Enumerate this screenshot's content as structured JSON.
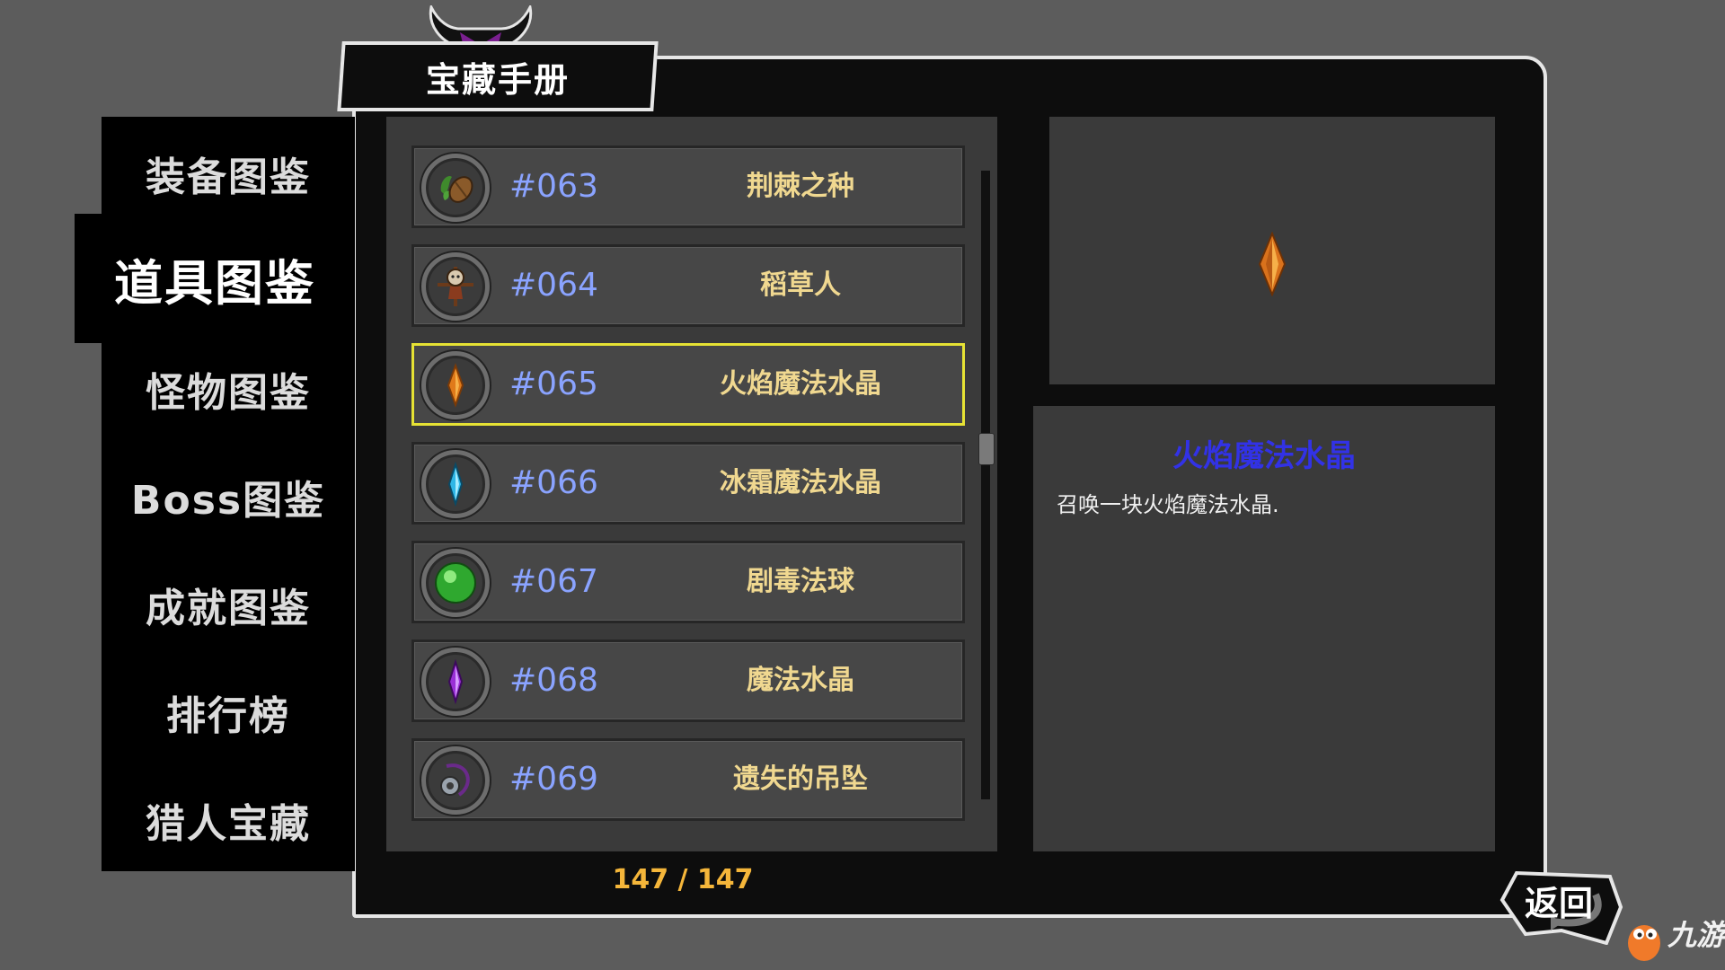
{
  "window": {
    "title": "宝藏手册"
  },
  "nav": {
    "items": [
      {
        "label": "装备图鉴",
        "active": false
      },
      {
        "label": "道具图鉴",
        "active": true
      },
      {
        "label": "怪物图鉴",
        "active": false
      },
      {
        "label": "Boss图鉴",
        "active": false
      },
      {
        "label": "成就图鉴",
        "active": false
      },
      {
        "label": "排行榜",
        "active": false
      },
      {
        "label": "猎人宝藏",
        "active": false
      }
    ]
  },
  "list": {
    "items": [
      {
        "number": "#063",
        "name": "荆棘之种",
        "icon": "thorn-seed-icon",
        "selected": false
      },
      {
        "number": "#064",
        "name": "稻草人",
        "icon": "scarecrow-icon",
        "selected": false
      },
      {
        "number": "#065",
        "name": "火焰魔法水晶",
        "icon": "fire-crystal-icon",
        "selected": true
      },
      {
        "number": "#066",
        "name": "冰霜魔法水晶",
        "icon": "ice-crystal-icon",
        "selected": false
      },
      {
        "number": "#067",
        "name": "剧毒法球",
        "icon": "poison-orb-icon",
        "selected": false
      },
      {
        "number": "#068",
        "name": "魔法水晶",
        "icon": "magic-crystal-icon",
        "selected": false
      },
      {
        "number": "#069",
        "name": "遗失的吊坠",
        "icon": "lost-pendant-icon",
        "selected": false
      }
    ],
    "page_count": "147 / 147",
    "scroll_fraction": 0.42
  },
  "detail": {
    "title": "火焰魔法水晶",
    "description": "召唤一块火焰魔法水晶.",
    "preview_icon": "fire-crystal-icon"
  },
  "back_button": {
    "label": "返回"
  },
  "watermark": {
    "text": "九游",
    "logo": "jiuyou-mascot-logo"
  },
  "colors": {
    "background": "#5c5c5c",
    "panel": "#3a3a3a",
    "item": "#474747",
    "selected_border": "#e6e234",
    "item_number": "#8aa3ff",
    "item_name": "#f0d890",
    "detail_title": "#3232e6",
    "page_count": "#f5b63a"
  }
}
